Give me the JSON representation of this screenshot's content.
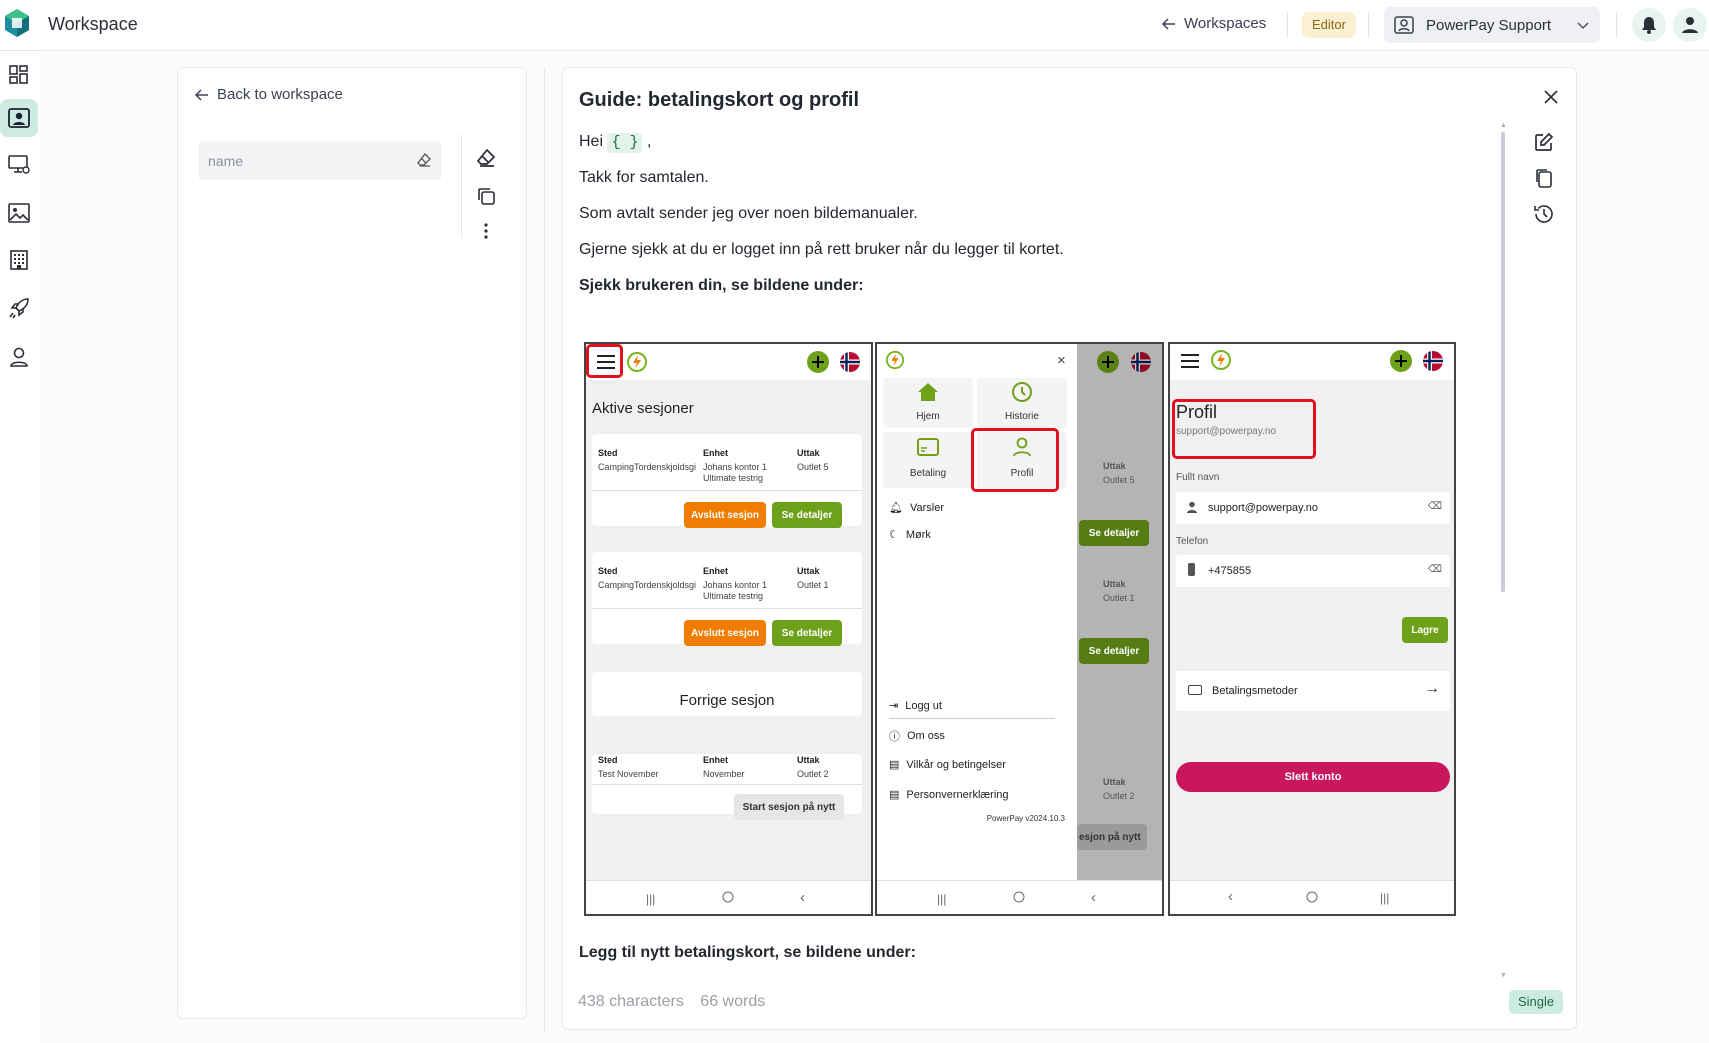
{
  "app": {
    "title": "Workspace"
  },
  "topbar": {
    "workspaces_link": "Workspaces",
    "role_badge": "Editor",
    "account_name": "PowerPay Support"
  },
  "sidebar": {
    "items": [
      {
        "icon": "dashboard-icon"
      },
      {
        "icon": "contact-card-icon",
        "active": true
      },
      {
        "icon": "monitor-settings-icon"
      },
      {
        "icon": "image-icon"
      },
      {
        "icon": "building-icon"
      },
      {
        "icon": "rocket-icon"
      },
      {
        "icon": "person-icon"
      }
    ]
  },
  "left_panel": {
    "back_label": "Back to workspace",
    "name_placeholder": "name"
  },
  "editor": {
    "title": "Guide: betalingskort og profil",
    "greeting_prefix": "Hei",
    "token": "{ }",
    "greeting_suffix": ",",
    "line2": "Takk for samtalen.",
    "line3": "Som avtalt sender jeg over noen bildemanualer.",
    "line4": "Gjerne sjekk at du er logget inn på rett bruker når du legger til kortet.",
    "heading1": "Sjekk brukeren din, se bildene under:",
    "heading2": "Legg til nytt betalingskort, se bildene under:",
    "char_count": "438 characters",
    "word_count": "66 words",
    "mode_badge": "Single"
  },
  "screenshots": {
    "phone1": {
      "section_title": "Aktive sesjoner",
      "col_sted": "Sted",
      "col_enhet": "Enhet",
      "col_uttak": "Uttak",
      "row1": {
        "sted": "CampingTordenskjoldsgi",
        "enhet1": "Johans kontor 1",
        "enhet2": "Ultimate testrig",
        "uttak": "Outlet 5"
      },
      "row2": {
        "sted": "CampingTordenskjoldsgi",
        "enhet1": "Johans kontor 1",
        "enhet2": "Ultimate testrig",
        "uttak": "Outlet 1"
      },
      "btn_end": "Avslutt sesjon",
      "btn_details": "Se detaljer",
      "prev_title": "Forrige sesjon",
      "row3": {
        "sted": "Test November",
        "enhet": "November",
        "uttak": "Outlet 2"
      },
      "btn_restart": "Start sesjon på nytt"
    },
    "phone2": {
      "home": "Hjem",
      "history": "Historie",
      "payment": "Betaling",
      "profile": "Profil",
      "alerts": "Varsler",
      "dark": "Mørk",
      "logout": "Logg ut",
      "about": "Om oss",
      "terms": "Vilkår og betingelser",
      "privacy": "Personvernerklæring",
      "version": "PowerPay v2024.10.3",
      "bg_uttak": "Uttak",
      "bg_outlet5": "Outlet 5",
      "bg_outlet1": "Outlet 1",
      "bg_outlet2": "Outlet 2",
      "bg_details": "Se detaljer",
      "bg_restart": "esjon på nytt"
    },
    "phone3": {
      "title": "Profil",
      "email_sub": "support@powerpay.no",
      "fullname_label": "Fullt navn",
      "fullname_value": "support@powerpay.no",
      "phone_label": "Telefon",
      "phone_value": "+475855",
      "save": "Lagre",
      "payment_methods": "Betalingsmetoder",
      "delete": "Slett konto"
    }
  },
  "colors": {
    "accent": "#1e9e6b",
    "active_nav_bg": "#cdebe1",
    "brand_green": "#6ea11a",
    "highlight_red": "#e0111b",
    "delete_red": "#c8175d"
  }
}
